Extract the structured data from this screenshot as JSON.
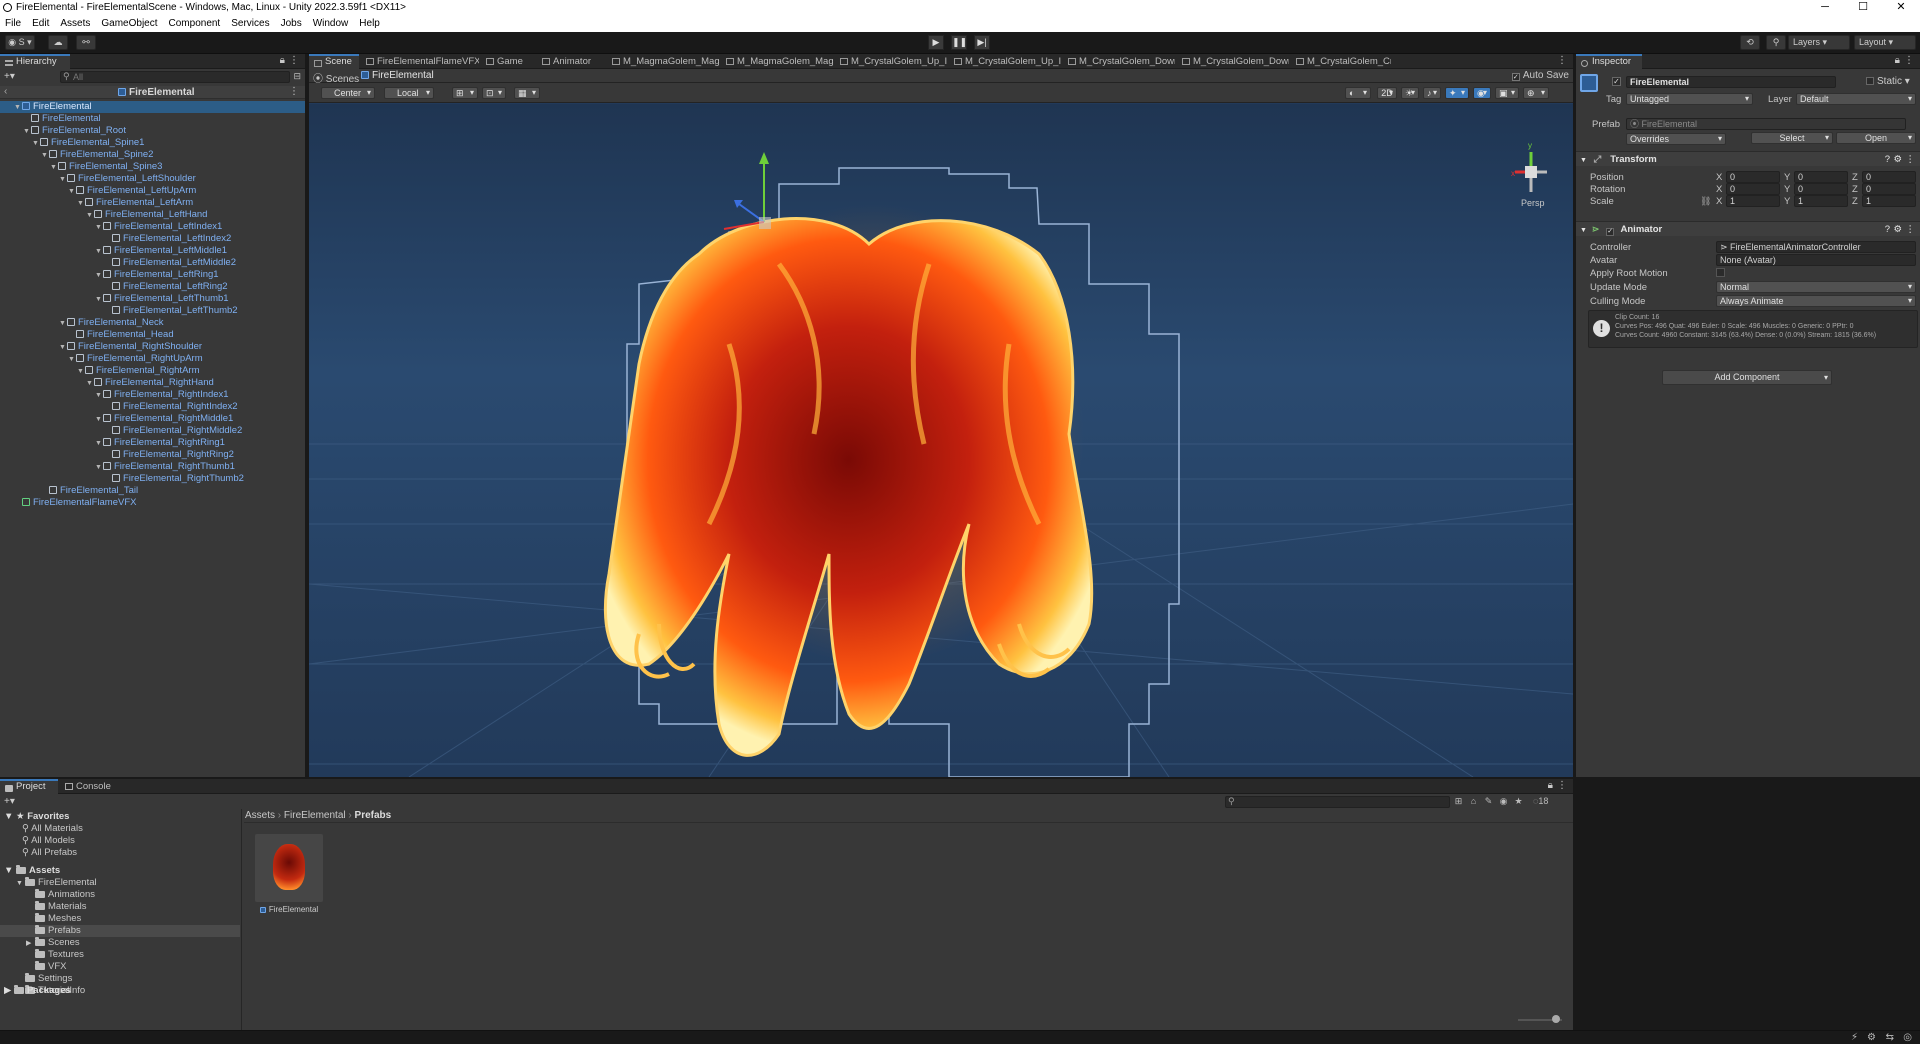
{
  "window": {
    "title": "FireElemental - FireElementalScene - Windows, Mac, Linux - Unity 2022.3.59f1 <DX11>",
    "minimize": "─",
    "maximize": "☐",
    "close": "✕"
  },
  "menu": [
    "File",
    "Edit",
    "Assets",
    "GameObject",
    "Component",
    "Services",
    "Jobs",
    "Window",
    "Help"
  ],
  "toolbar": {
    "account": "S",
    "layers": "Layers",
    "layout": "Layout",
    "play_icon": "▶",
    "pause_icon": "❚❚",
    "step_icon": "▶|"
  },
  "hierarchy": {
    "tab": "Hierarchy",
    "search_placeholder": "All",
    "scene_root": "FireElemental",
    "items": [
      {
        "label": "FireElemental",
        "depth": 0,
        "expand": "▼",
        "type": "blue"
      },
      {
        "label": "FireElemental",
        "depth": 1,
        "expand": "",
        "type": "plain"
      },
      {
        "label": "FireElemental_Root",
        "depth": 1,
        "expand": "▼",
        "type": "plain"
      },
      {
        "label": "FireElemental_Spine1",
        "depth": 2,
        "expand": "▼",
        "type": "plain"
      },
      {
        "label": "FireElemental_Spine2",
        "depth": 3,
        "expand": "▼",
        "type": "plain"
      },
      {
        "label": "FireElemental_Spine3",
        "depth": 4,
        "expand": "▼",
        "type": "plain"
      },
      {
        "label": "FireElemental_LeftShoulder",
        "depth": 5,
        "expand": "▼",
        "type": "plain"
      },
      {
        "label": "FireElemental_LeftUpArm",
        "depth": 6,
        "expand": "▼",
        "type": "plain"
      },
      {
        "label": "FireElemental_LeftArm",
        "depth": 7,
        "expand": "▼",
        "type": "plain"
      },
      {
        "label": "FireElemental_LeftHand",
        "depth": 8,
        "expand": "▼",
        "type": "plain"
      },
      {
        "label": "FireElemental_LeftIndex1",
        "depth": 9,
        "expand": "▼",
        "type": "plain"
      },
      {
        "label": "FireElemental_LeftIndex2",
        "depth": 10,
        "expand": "",
        "type": "plain"
      },
      {
        "label": "FireElemental_LeftMiddle1",
        "depth": 9,
        "expand": "▼",
        "type": "plain"
      },
      {
        "label": "FireElemental_LeftMiddle2",
        "depth": 10,
        "expand": "",
        "type": "plain"
      },
      {
        "label": "FireElemental_LeftRing1",
        "depth": 9,
        "expand": "▼",
        "type": "plain"
      },
      {
        "label": "FireElemental_LeftRing2",
        "depth": 10,
        "expand": "",
        "type": "plain"
      },
      {
        "label": "FireElemental_LeftThumb1",
        "depth": 9,
        "expand": "▼",
        "type": "plain"
      },
      {
        "label": "FireElemental_LeftThumb2",
        "depth": 10,
        "expand": "",
        "type": "plain"
      },
      {
        "label": "FireElemental_Neck",
        "depth": 5,
        "expand": "▼",
        "type": "plain"
      },
      {
        "label": "FireElemental_Head",
        "depth": 6,
        "expand": "",
        "type": "plain"
      },
      {
        "label": "FireElemental_RightShoulder",
        "depth": 5,
        "expand": "▼",
        "type": "plain"
      },
      {
        "label": "FireElemental_RightUpArm",
        "depth": 6,
        "expand": "▼",
        "type": "plain"
      },
      {
        "label": "FireElemental_RightArm",
        "depth": 7,
        "expand": "▼",
        "type": "plain"
      },
      {
        "label": "FireElemental_RightHand",
        "depth": 8,
        "expand": "▼",
        "type": "plain"
      },
      {
        "label": "FireElemental_RightIndex1",
        "depth": 9,
        "expand": "▼",
        "type": "plain"
      },
      {
        "label": "FireElemental_RightIndex2",
        "depth": 10,
        "expand": "",
        "type": "plain"
      },
      {
        "label": "FireElemental_RightMiddle1",
        "depth": 9,
        "expand": "▼",
        "type": "plain"
      },
      {
        "label": "FireElemental_RightMiddle2",
        "depth": 10,
        "expand": "",
        "type": "plain"
      },
      {
        "label": "FireElemental_RightRing1",
        "depth": 9,
        "expand": "▼",
        "type": "plain"
      },
      {
        "label": "FireElemental_RightRing2",
        "depth": 10,
        "expand": "",
        "type": "plain"
      },
      {
        "label": "FireElemental_RightThumb1",
        "depth": 9,
        "expand": "▼",
        "type": "plain"
      },
      {
        "label": "FireElemental_RightThumb2",
        "depth": 10,
        "expand": "",
        "type": "plain"
      },
      {
        "label": "FireElemental_Tail",
        "depth": 3,
        "expand": "",
        "type": "plain"
      },
      {
        "label": "FireElementalFlameVFX",
        "depth": 0,
        "expand": "",
        "type": "green"
      }
    ]
  },
  "scene": {
    "tabs": [
      "Scene",
      "FireElementalFlameVFX",
      "Game",
      "Animator",
      "M_MagmaGolem_Magma...",
      "M_MagmaGolem_Magma...",
      "M_CrystalGolem_Up_Ice_...",
      "M_CrystalGolem_Up_Ice_...",
      "M_CrystalGolem_Down_Ic...",
      "M_CrystalGolem_Down_Ic...",
      "M_CrystalGolem_Cryst"
    ],
    "breadcrumb_scenes": "Scenes",
    "breadcrumb_current": "FireElemental",
    "auto_save": "Auto Save",
    "pivot": "Center",
    "space": "Local",
    "mode_2d": "2D",
    "persp": "Persp",
    "gizmo_x": "x",
    "gizmo_y": "y",
    "gizmo_z": "z"
  },
  "inspector": {
    "tab": "Inspector",
    "object_name": "FireElemental",
    "static_label": "Static",
    "tag_label": "Tag",
    "tag_value": "Untagged",
    "layer_label": "Layer",
    "layer_value": "Default",
    "prefab_label": "Prefab",
    "prefab_value": "FireElemental",
    "overrides": "Overrides",
    "select": "Select",
    "open": "Open",
    "transform": {
      "title": "Transform",
      "position_label": "Position",
      "rotation_label": "Rotation",
      "scale_label": "Scale",
      "position": {
        "x": "0",
        "y": "0",
        "z": "0"
      },
      "rotation": {
        "x": "0",
        "y": "0",
        "z": "0"
      },
      "scale": {
        "x": "1",
        "y": "1",
        "z": "1"
      }
    },
    "animator": {
      "title": "Animator",
      "controller_label": "Controller",
      "controller_value": "FireElementalAnimatorController",
      "avatar_label": "Avatar",
      "avatar_value": "None (Avatar)",
      "apply_root_motion_label": "Apply Root Motion",
      "update_mode_label": "Update Mode",
      "update_mode_value": "Normal",
      "culling_mode_label": "Culling Mode",
      "culling_mode_value": "Always Animate",
      "info_line1": "Clip Count: 16",
      "info_line2": "Curves Pos: 496 Quat: 496 Euler: 0 Scale: 496 Muscles: 0 Generic: 0 PPtr: 0",
      "info_line3": "Curves Count: 4960 Constant: 3145 (63.4%) Dense: 0 (0.0%) Stream: 1815 (36.6%)"
    },
    "add_component": "Add Component"
  },
  "project": {
    "tab_project": "Project",
    "tab_console": "Console",
    "favorites": "Favorites",
    "favorite_items": [
      "All Materials",
      "All Models",
      "All Prefabs"
    ],
    "assets": "Assets",
    "tree": [
      {
        "label": "FireElemental",
        "depth": 1,
        "expand": "▼"
      },
      {
        "label": "Animations",
        "depth": 2,
        "expand": ""
      },
      {
        "label": "Materials",
        "depth": 2,
        "expand": ""
      },
      {
        "label": "Meshes",
        "depth": 2,
        "expand": ""
      },
      {
        "label": "Prefabs",
        "depth": 2,
        "expand": ""
      },
      {
        "label": "Scenes",
        "depth": 2,
        "expand": "▶"
      },
      {
        "label": "Textures",
        "depth": 2,
        "expand": ""
      },
      {
        "label": "VFX",
        "depth": 2,
        "expand": ""
      },
      {
        "label": "Settings",
        "depth": 1,
        "expand": ""
      },
      {
        "label": "TutorialInfo",
        "depth": 1,
        "expand": "▶"
      }
    ],
    "packages": "Packages",
    "breadcrumb": [
      "Assets",
      "FireElemental",
      "Prefabs"
    ],
    "asset_name": "FireElemental",
    "hidden_count": "18"
  },
  "colors": {
    "accent": "#3a79bb",
    "scene_bg": "#223a5a",
    "hierarchy_text": "#7fb0f2",
    "selected": "#2c5d87"
  }
}
